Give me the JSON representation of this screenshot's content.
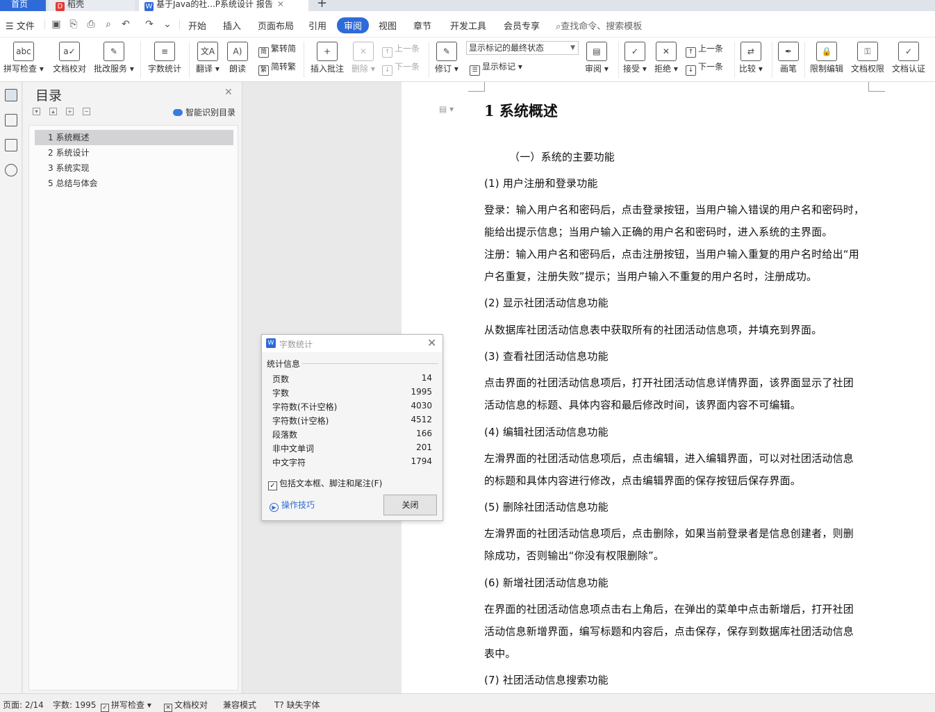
{
  "tabs": {
    "home": "首页",
    "daoke": "稻壳",
    "doc": "基于Java的社...P系统设计 报告"
  },
  "menu": {
    "file": "文件",
    "items": [
      "开始",
      "插入",
      "页面布局",
      "引用",
      "审阅",
      "视图",
      "章节",
      "开发工具",
      "会员专享"
    ],
    "active": "审阅",
    "search_placeholder": "查找命令、搜索模板"
  },
  "ribbon": {
    "spellcheck": "拼写检查",
    "doc_proof": "文档校对",
    "review_service": "批改服务",
    "word_count": "字数统计",
    "translate": "翻译",
    "read_aloud": "朗读",
    "trad_to_simp": "繁转简",
    "simp_to_trad": "简转繁",
    "insert_comment": "插入批注",
    "delete": "删除",
    "prev_comment": "上一条",
    "next_comment": "下一条",
    "track_changes": "修订",
    "markup_state": "显示标记的最终状态",
    "show_markup": "显示标记",
    "review": "审阅",
    "accept": "接受",
    "reject": "拒绝",
    "prev_change": "上一条",
    "next_change": "下一条",
    "compare": "比较",
    "pen": "画笔",
    "restrict_edit": "限制编辑",
    "doc_permission": "文档权限",
    "doc_cert": "文档认证"
  },
  "toc": {
    "title": "目录",
    "smart_label": "智能识别目录",
    "items": [
      "1  系统概述",
      "2  系统设计",
      "3  系统实现",
      "5  总结与体会"
    ]
  },
  "document": {
    "heading": "1  系统概述",
    "lines": [
      "（一）系统的主要功能",
      "(1) 用户注册和登录功能",
      "登录：输入用户名和密码后，点击登录按钮，当用户输入错误的用户名和密码时，",
      "能给出提示信息；当用户输入正确的用户名和密码时，进入系统的主界面。",
      "注册：输入用户名和密码后，点击注册按钮，当用户输入重复的用户名时给出“用",
      "户名重复，注册失败”提示；当用户输入不重复的用户名时，注册成功。",
      "(2) 显示社团活动信息功能",
      "从数据库社团活动信息表中获取所有的社团活动信息项，并填充到界面。",
      "(3) 查看社团活动信息功能",
      "点击界面的社团活动信息项后，打开社团活动信息详情界面，该界面显示了社团",
      "活动信息的标题、具体内容和最后修改时间，该界面内容不可编辑。",
      "(4) 编辑社团活动信息功能",
      "左滑界面的社团活动信息项后，点击编辑，进入编辑界面，可以对社团活动信息",
      "的标题和具体内容进行修改，点击编辑界面的保存按钮后保存界面。",
      "(5) 删除社团活动信息功能",
      "左滑界面的社团活动信息项后，点击删除，如果当前登录者是信息创建者，则删",
      "除成功，否则输出“你没有权限删除”。",
      "(6) 新增社团活动信息功能",
      "在界面的社团活动信息项点击右上角后，在弹出的菜单中点击新增后，打开社团",
      "活动信息新增界面，编写标题和内容后，点击保存，保存到数据库社团活动信息",
      "表中。",
      "(7) 社团活动信息搜索功能"
    ]
  },
  "dialog": {
    "title": "字数统计",
    "section": "统计信息",
    "stats": [
      {
        "label": "页数",
        "value": "14"
      },
      {
        "label": "字数",
        "value": "1995"
      },
      {
        "label": "字符数(不计空格)",
        "value": "4030"
      },
      {
        "label": "字符数(计空格)",
        "value": "4512"
      },
      {
        "label": "段落数",
        "value": "166"
      },
      {
        "label": "非中文单词",
        "value": "201"
      },
      {
        "label": "中文字符",
        "value": "1794"
      }
    ],
    "include_label": "包括文本框、脚注和尾注(F)",
    "include_checked": true,
    "tips": "操作技巧",
    "close_btn": "关闭"
  },
  "status": {
    "page": "页面: 2/14",
    "words": "字数: 1995",
    "spell": "拼写检查",
    "proof": "文档校对",
    "compat": "兼容模式",
    "missing_font": "缺失字体"
  },
  "colors": {
    "accent": "#2f6bd8",
    "toc_selected": "#d3d3d6"
  }
}
